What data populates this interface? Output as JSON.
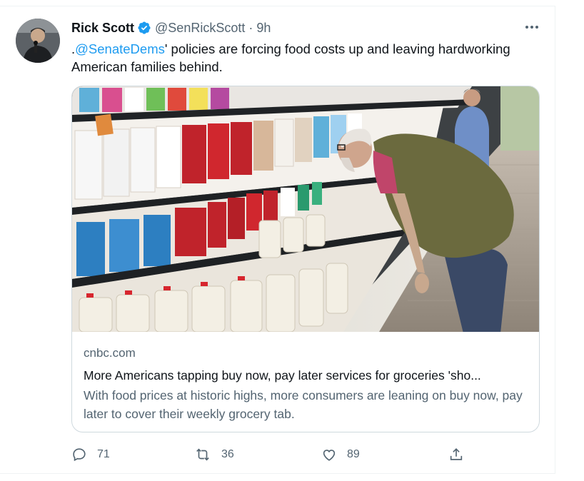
{
  "tweet": {
    "author_name": "Rick Scott",
    "verified_icon": "verified-badge-icon",
    "handle": "@SenRickScott",
    "separator": "·",
    "timestamp": "9h",
    "more_icon": "more-horizontal-icon",
    "text_prefix": ".",
    "mention": "@SenateDems",
    "text_rest": "' policies are forcing food costs up and leaving hardworking American families behind."
  },
  "card": {
    "image_icon": "photo",
    "domain": "cnbc.com",
    "title": "More Americans tapping buy now, pay later services for groceries 'sho...",
    "description": "With food prices at historic highs, more consumers are leaning on buy now, pay later to cover their weekly grocery tab."
  },
  "actions": {
    "reply_count": "71",
    "retweet_count": "36",
    "like_count": "89",
    "reply_icon": "reply-icon",
    "retweet_icon": "retweet-icon",
    "like_icon": "heart-icon",
    "share_icon": "share-icon"
  },
  "colors": {
    "accent": "#1d9bf0",
    "text_primary": "#0f1419",
    "text_secondary": "#536471",
    "border": "#cfd9de"
  }
}
